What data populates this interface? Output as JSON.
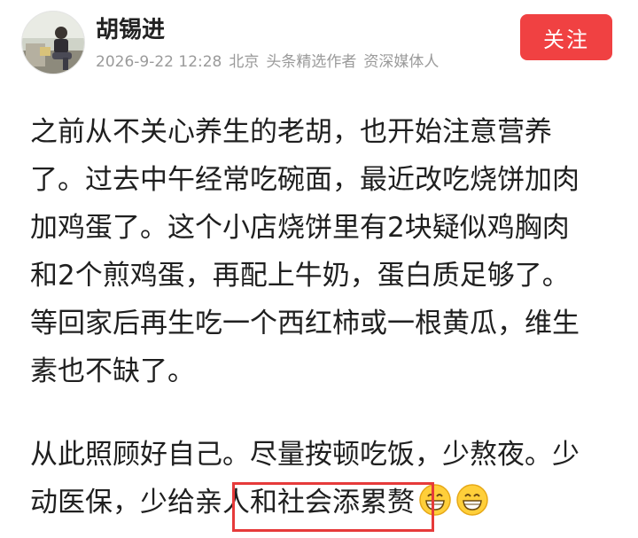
{
  "author": {
    "name": "胡锡进",
    "timestamp": "2026-9-22 12:28",
    "location": "北京",
    "badges": [
      "头条精选作者",
      "资深媒体人"
    ],
    "avatar_icon": "person-photo-avatar"
  },
  "follow_button": {
    "label": "关注",
    "color": "#f04142"
  },
  "post": {
    "paragraph1": [
      "之前从不关心养生的老胡，也开始注意营养",
      "了。过去中午经常吃碗面，最近改吃烧饼加肉",
      "加鸡蛋了。这个小店烧饼里有2块疑似鸡胸肉",
      "和2个煎鸡蛋，再配上牛奶，蛋白质足够了。",
      "等回家后再生吃一个西红柿或一根黄瓜，维生",
      "素也不缺了。"
    ],
    "paragraph2": [
      "从此照顾好自己。尽量按顿吃饭，少熬夜。少",
      "动医保，少给亲人和社会添累赘"
    ],
    "emojis": [
      "grinning-face-icon",
      "grinning-face-icon"
    ]
  },
  "annotation": {
    "color": "#e63a3a"
  }
}
